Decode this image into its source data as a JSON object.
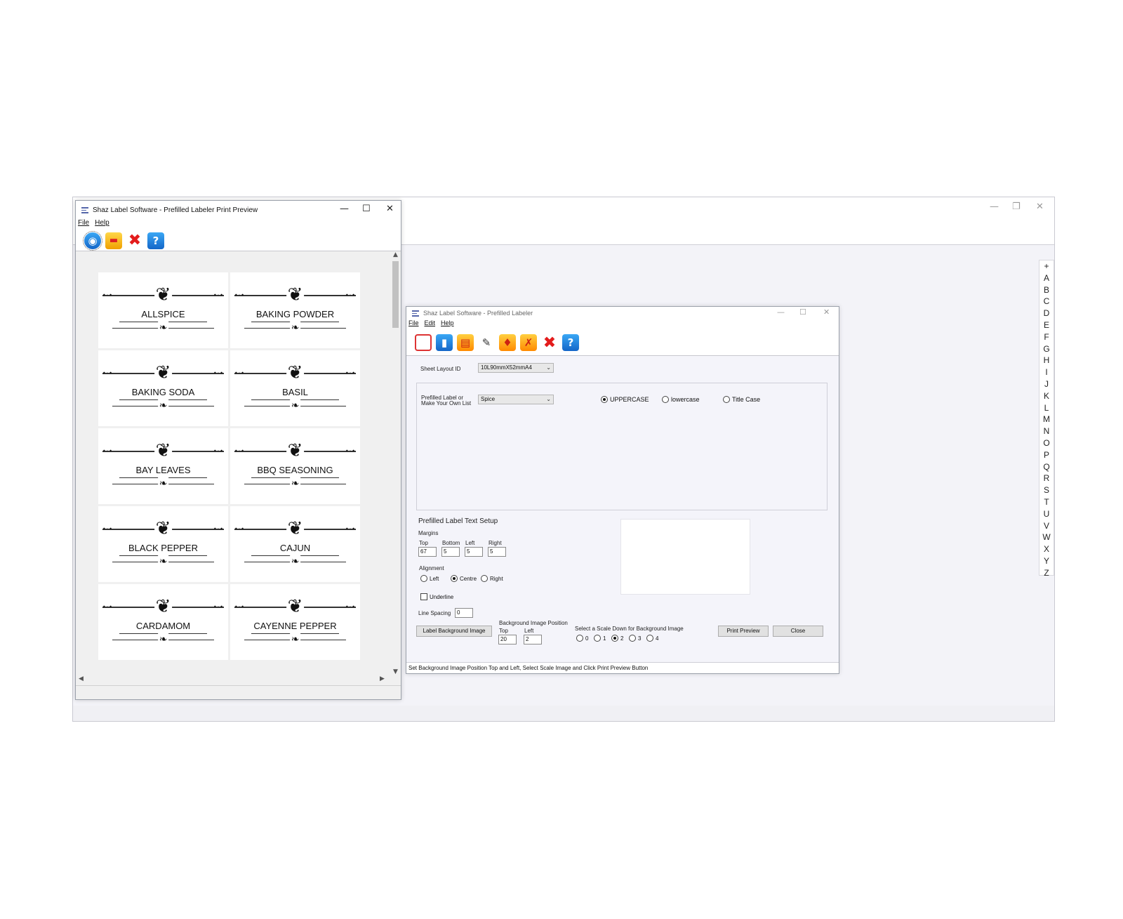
{
  "main_window": {
    "controls": {
      "minimize": "—",
      "restore": "❐",
      "close": "✕"
    },
    "alphabet": [
      "+",
      "A",
      "B",
      "C",
      "D",
      "E",
      "F",
      "G",
      "H",
      "I",
      "J",
      "K",
      "L",
      "M",
      "N",
      "O",
      "P",
      "Q",
      "R",
      "S",
      "T",
      "U",
      "V",
      "W",
      "X",
      "Y",
      "Z"
    ]
  },
  "print_preview": {
    "title": "Shaz Label Software - Prefilled Labeler Print Preview",
    "controls": {
      "minimize": "—",
      "maximize": "☐",
      "close": "✕"
    },
    "menu": [
      "File",
      "Help"
    ],
    "labels": [
      "ALLSPICE",
      "BAKING POWDER",
      "BAKING SODA",
      "BASIL",
      "BAY LEAVES",
      "BBQ SEASONING",
      "BLACK PEPPER",
      "CAJUN",
      "CARDAMOM",
      "CAYENNE PEPPER"
    ],
    "toolbar_icons": [
      "globe-icon",
      "printer-icon",
      "close-x-icon",
      "help-icon"
    ]
  },
  "labeler": {
    "title": "Shaz Label Software - Prefilled Labeler",
    "controls": {
      "minimize": "—",
      "maximize": "☐",
      "close": "✕"
    },
    "menu": [
      "File",
      "Edit",
      "Help"
    ],
    "sheet_layout_label": "Sheet Layout ID",
    "sheet_layout_value": "10L90mmX52mmA4",
    "prefilled_label_l1": "Prefilled Label or",
    "prefilled_label_l2": "Make Your Own List",
    "prefilled_value": "Spice",
    "case_options": {
      "upper": "UPPERCASE",
      "lower": "lowercase",
      "title": "Title Case",
      "selected": "upper"
    },
    "text_setup_title": "Prefilled Label Text Setup",
    "margins_label": "Margins",
    "margins": {
      "top_label": "Top",
      "bottom_label": "Bottom",
      "left_label": "Left",
      "right_label": "Right",
      "top": "67",
      "bottom": "5",
      "left": "5",
      "right": "5"
    },
    "alignment_label": "Alignment",
    "alignment": {
      "left": "Left",
      "centre": "Centre",
      "right": "Right",
      "selected": "centre"
    },
    "underline_label": "Underline",
    "line_spacing_label": "Line Spacing",
    "line_spacing_value": "0",
    "bg_button": "Label Background Image",
    "bg_pos_label": "Background Image Position",
    "bg_top_label": "Top",
    "bg_left_label": "Left",
    "bg_top": "20",
    "bg_left": "2",
    "scale_label": "Select a Scale Down for Background Image",
    "scale_options": [
      "0",
      "1",
      "2",
      "3",
      "4"
    ],
    "scale_selected": "2",
    "print_preview_button": "Print Preview",
    "close_button": "Close",
    "status": "Set Background Image Position Top and Left, Select Scale Image and Click Print Preview Button"
  }
}
